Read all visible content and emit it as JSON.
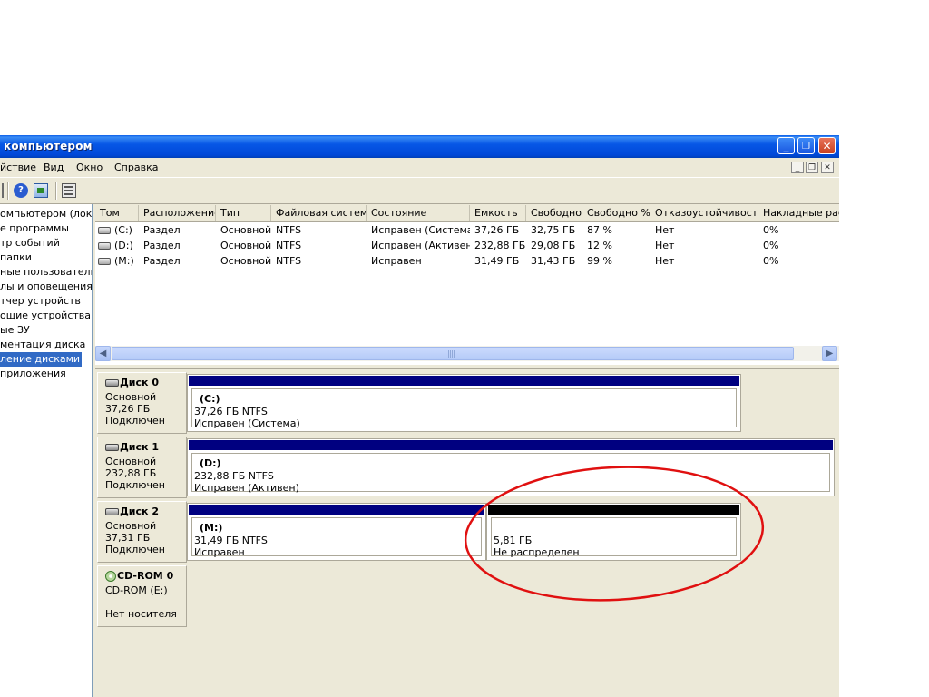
{
  "window": {
    "title": "компьютером",
    "controls": {
      "minimize": "_",
      "restore": "❐",
      "close": "✕"
    }
  },
  "menu": [
    {
      "label": "йствие"
    },
    {
      "label": "Вид"
    },
    {
      "label": "Окно"
    },
    {
      "label": "Справка"
    }
  ],
  "toolbar": {
    "icons": [
      "nav-arrow-icon",
      "help-icon",
      "refresh-icon",
      "properties-icon"
    ]
  },
  "tree": {
    "items": [
      {
        "label": "омпьютером (локалі"
      },
      {
        "label": "е программы"
      },
      {
        "label": "тр событий"
      },
      {
        "label": "папки"
      },
      {
        "label": "ные пользователи"
      },
      {
        "label": "лы и оповещения пр"
      },
      {
        "label": "тчер устройств"
      },
      {
        "label": "ощие устройства"
      },
      {
        "label": "ые ЗУ"
      },
      {
        "label": "ментация диска"
      },
      {
        "label": "ление дисками",
        "selected": true
      },
      {
        "label": "приложения"
      }
    ]
  },
  "volume_list": {
    "columns": [
      "Том",
      "Расположение",
      "Тип",
      "Файловая система",
      "Состояние",
      "Емкость",
      "Свободно",
      "Свободно %",
      "Отказоустойчивость",
      "Накладные рас"
    ],
    "rows": [
      [
        "(C:)",
        "Раздел",
        "Основной",
        "NTFS",
        "Исправен (Система)",
        "37,26 ГБ",
        "32,75 ГБ",
        "87 %",
        "Нет",
        "0%"
      ],
      [
        "(D:)",
        "Раздел",
        "Основной",
        "NTFS",
        "Исправен (Активен)",
        "232,88 ГБ",
        "29,08 ГБ",
        "12 %",
        "Нет",
        "0%"
      ],
      [
        "(M:)",
        "Раздел",
        "Основной",
        "NTFS",
        "Исправен",
        "31,49 ГБ",
        "31,43 ГБ",
        "99 %",
        "Нет",
        "0%"
      ]
    ]
  },
  "disks": [
    {
      "name": "Диск 0",
      "type": "Основной",
      "size": "37,26 ГБ",
      "status": "Подключен",
      "partitions": [
        {
          "name": "(C:)",
          "size": "37,26 ГБ NTFS",
          "state": "Исправен (Система)",
          "bar_color": "#000080"
        }
      ]
    },
    {
      "name": "Диск 1",
      "type": "Основной",
      "size": "232,88 ГБ",
      "status": "Подключен",
      "partitions": [
        {
          "name": "(D:)",
          "size": "232,88 ГБ NTFS",
          "state": "Исправен (Активен)",
          "bar_color": "#000080"
        }
      ]
    },
    {
      "name": "Диск 2",
      "type": "Основной",
      "size": "37,31 ГБ",
      "status": "Подключен",
      "partitions": [
        {
          "name": "(M:)",
          "size": "31,49 ГБ NTFS",
          "state": "Исправен",
          "bar_color": "#000080"
        },
        {
          "name": "",
          "size": "5,81 ГБ",
          "state": "Не распределен",
          "bar_color": "#000000"
        }
      ]
    }
  ],
  "cdrom": {
    "name": "CD-ROM 0",
    "drive": "CD-ROM (E:)",
    "status": "Нет носителя"
  },
  "colors": {
    "primary_partition": "#000080",
    "unallocated": "#000000",
    "annotation": "#e01010"
  }
}
